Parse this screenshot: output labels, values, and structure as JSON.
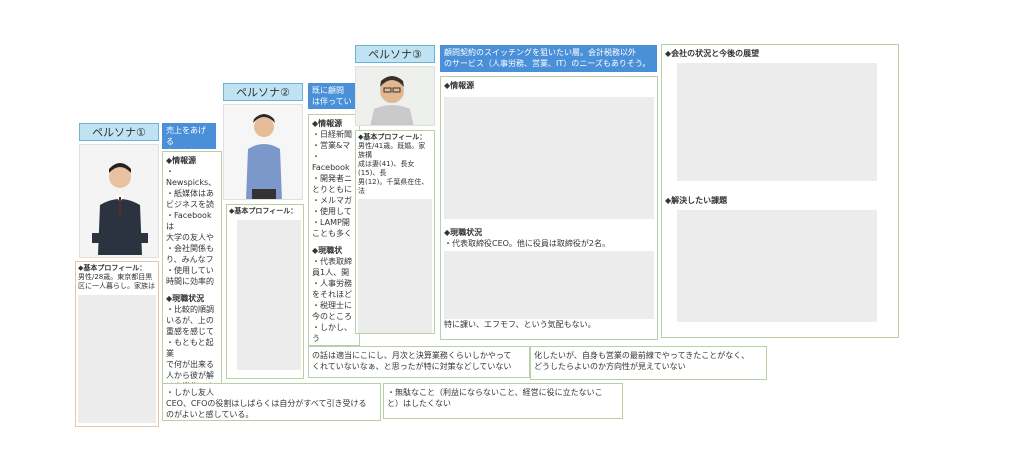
{
  "persona1": {
    "label": "ペルソナ①",
    "header": "売上をあげる\nふことについ",
    "profile_title": "◆基本プロフィール：",
    "profile": "男性/28歳。東京都目黒\n区に一人暮らし。家族は",
    "info_title": "◆情報源",
    "info_lines": "・Newspicks、\n・紙媒体はあ\nビジネスを読\n・Facebookは\n大学の友人や\n・会社関係も\nり、みんなフ\n・使用してい\n時間に効率的",
    "status_title": "◆現職状況",
    "status_lines": "・比較的順調\nいるが、上の\n重感を感じて\n・もともと起業\nで何が出来る\n人から彼が解\nは事業化でき\n運めている。",
    "bottom_lines": "・しかし友人\nCEO、CFOの役割はしばらくは自分がすべて引き受ける\nのがよいと感している。"
  },
  "persona2": {
    "label": "ペルソナ②",
    "header": "既に顧問\nは伴ってい",
    "profile_title": "◆基本プロフィール：",
    "info_title": "◆情報源",
    "info_lines": "・日経新聞\n・営業&マ\n・Facebook\n・開発者ニ\nとりともに\n・メルマガ\n・使用して\n・LAMP開\nことも多く",
    "status_title": "◆現職状",
    "status_lines": "・代表取締\n員1人、開\n・人事労務\nをそれほど\n・税理士に\n今のところ\n・しかし、う\nいたところ\nている様子",
    "bottom_lines": "の話は適当にこにし、月次と決算業務くらいしかやって\nくれていないなぁ、と思ったが特に対策などしていない",
    "problem_line": "・無駄なこと（利益にならないこと、経営に役に立たないこ\nと）はしたくない"
  },
  "persona3": {
    "label": "ペルソナ③",
    "header": "顧問契約のスイッチングを狙いたい層。会計税務以外\nのサービス（人事労務、営業、IT）のニーズもありそう。",
    "profile_title": "◆基本プロフィール：",
    "profile": "男性/41歳。既婚。家族構\n成は妻(41)、長女(15)、長\n男(12)。千葉県在住、法",
    "info_title": "◆情報源",
    "status_title": "◆現職状況",
    "status_first": "・代表取締役CEO。他に役員は取締役が2名。",
    "status_last": "特に課い、エフモフ、という気配もない。",
    "bottom_lines": "化したいが、自身も営業の最前線でやってきたことがなく、\nどうしたらよいのか方向性が見えていない"
  },
  "persona4": {
    "company_title": "◆会社の状況と今後の展望",
    "issues_title": "◆解決したい課題"
  }
}
